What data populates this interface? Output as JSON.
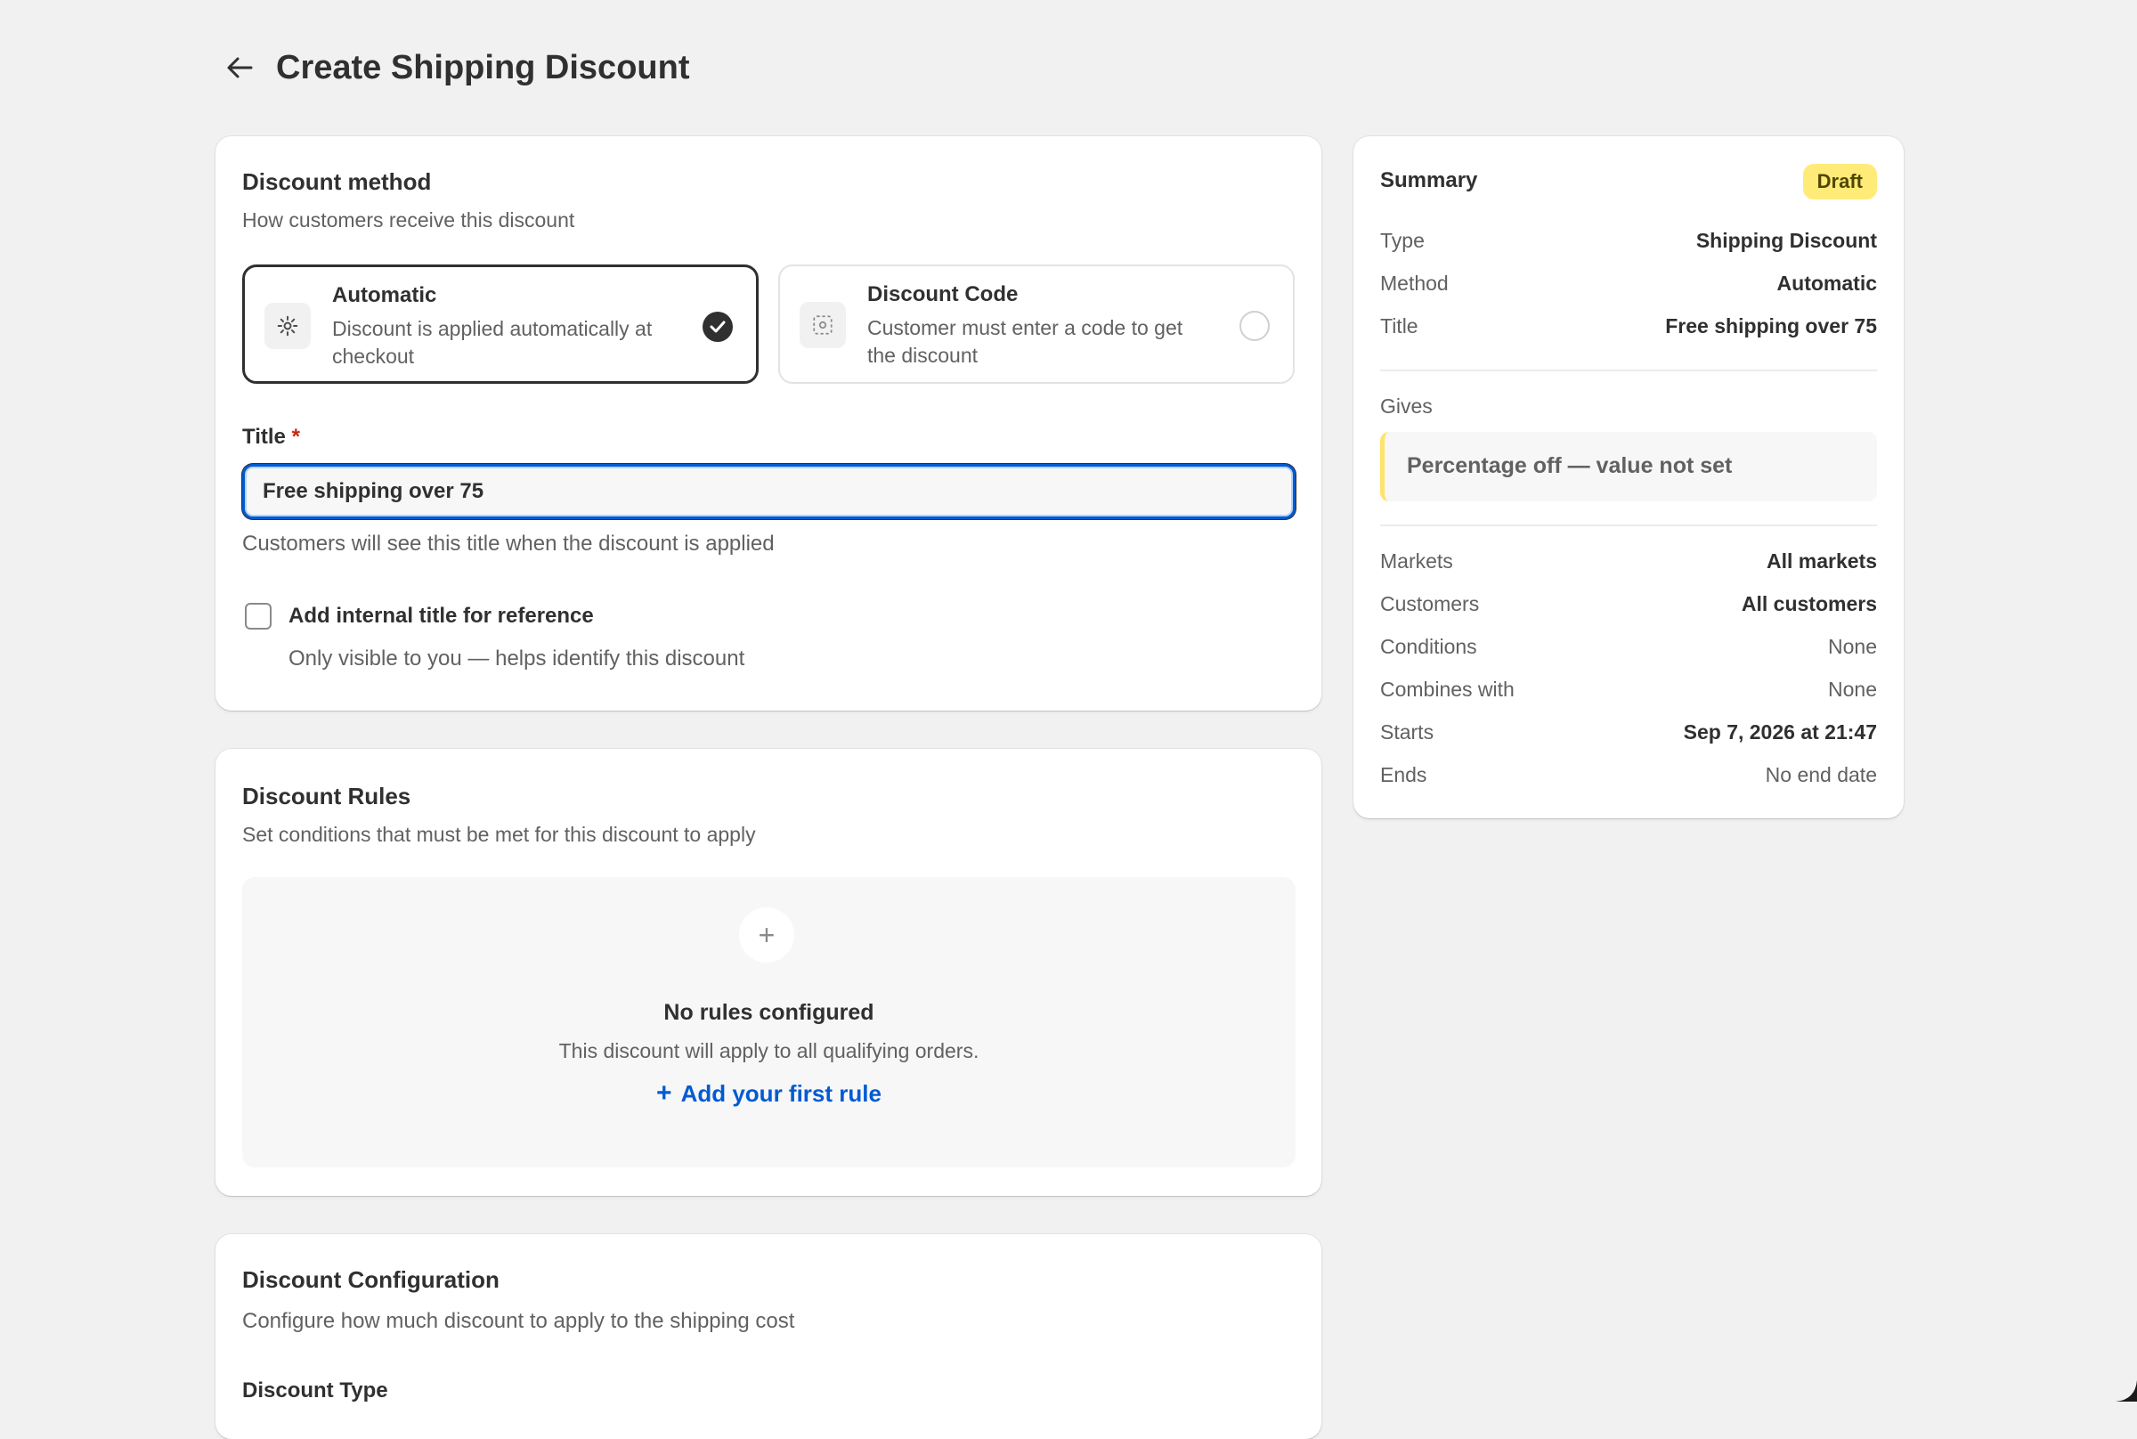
{
  "header": {
    "title": "Create Shipping Discount"
  },
  "method_card": {
    "title": "Discount method",
    "subtitle": "How customers receive this discount",
    "options": [
      {
        "title": "Automatic",
        "description": "Discount is applied automatically at checkout",
        "selected": true,
        "icon": "gear-icon"
      },
      {
        "title": "Discount Code",
        "description": "Customer must enter a code to get the discount",
        "selected": false,
        "icon": "code-icon"
      }
    ],
    "title_field": {
      "label": "Title",
      "required_mark": "*",
      "value": "Free shipping over 75",
      "helper": "Customers will see this title when the discount is applied"
    },
    "internal_title": {
      "label": "Add internal title for reference",
      "helper": "Only visible to you — helps identify this discount",
      "checked": false
    }
  },
  "rules_card": {
    "title": "Discount Rules",
    "subtitle": "Set conditions that must be met for this discount to apply",
    "empty_title": "No rules configured",
    "empty_subtitle": "This discount will apply to all qualifying orders.",
    "add_rule_label": "Add your first rule"
  },
  "config_card": {
    "title": "Discount Configuration",
    "subtitle": "Configure how much discount to apply to the shipping cost",
    "discount_type_label": "Discount Type"
  },
  "summary": {
    "title": "Summary",
    "badge": "Draft",
    "rows_top": [
      {
        "key": "Type",
        "value": "Shipping Discount"
      },
      {
        "key": "Method",
        "value": "Automatic"
      },
      {
        "key": "Title",
        "value": "Free shipping over 75"
      }
    ],
    "gives_label": "Gives",
    "gives_value": "Percentage off — value not set",
    "rows_bottom": [
      {
        "key": "Markets",
        "value": "All markets",
        "muted": false
      },
      {
        "key": "Customers",
        "value": "All customers",
        "muted": false
      },
      {
        "key": "Conditions",
        "value": "None",
        "muted": true
      },
      {
        "key": "Combines with",
        "value": "None",
        "muted": true
      },
      {
        "key": "Starts",
        "value": "Sep 7, 2026 at 21:47",
        "muted": false
      },
      {
        "key": "Ends",
        "value": "No end date",
        "muted": true
      }
    ]
  },
  "colors": {
    "accent": "#005bd3",
    "badge_bg": "#ffeb78",
    "page_bg": "#f1f1f1"
  }
}
